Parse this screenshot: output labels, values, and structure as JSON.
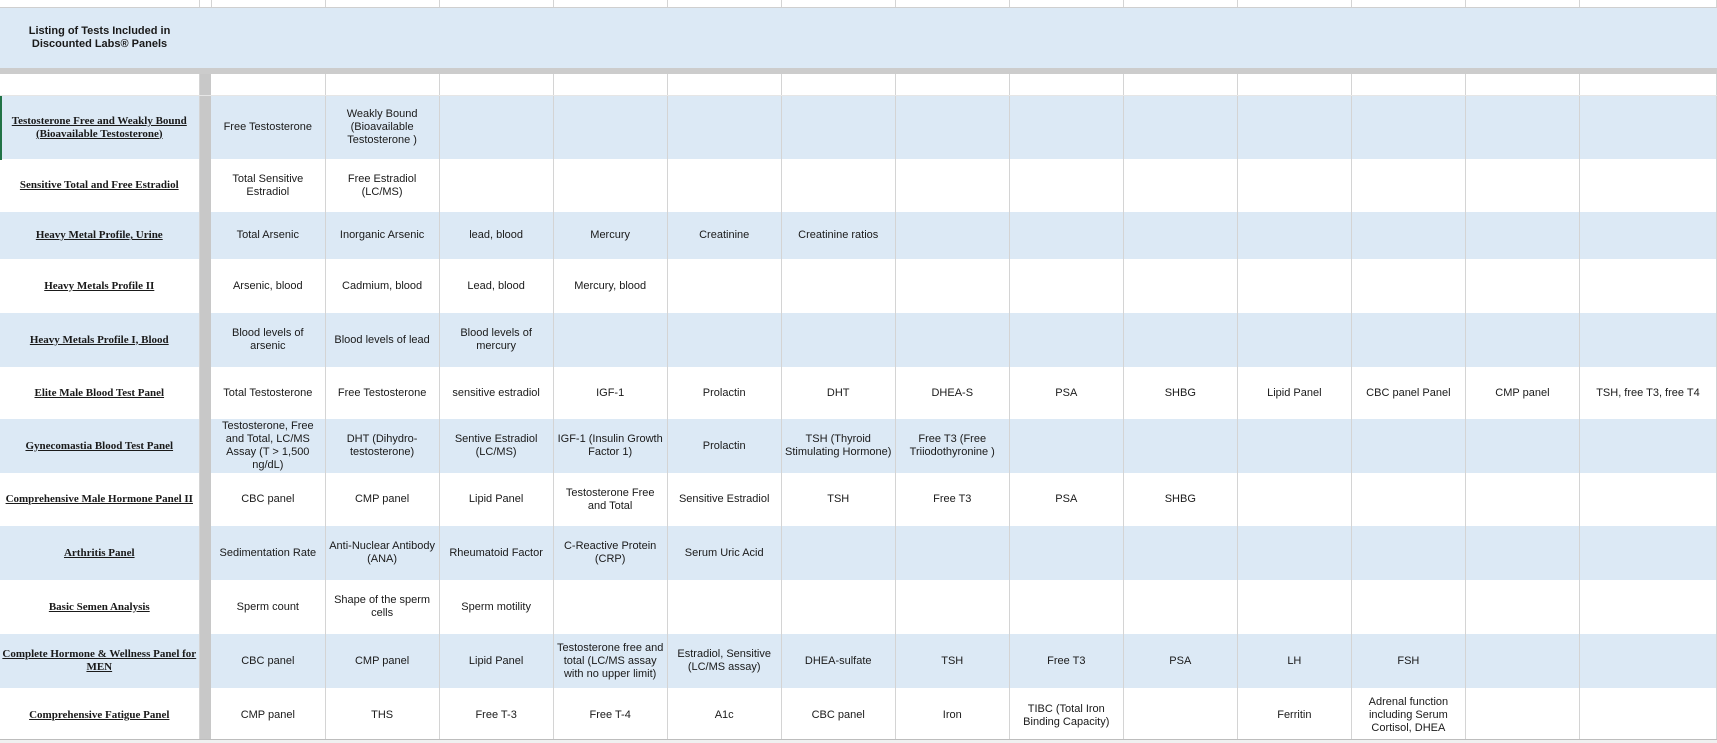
{
  "title_line1": "Listing of Tests Included in",
  "title_line2": "Discounted Labs® Panels",
  "rows": [
    {
      "panel": "Testosterone Free and Weakly Bound (Bioavailable Testosterone)",
      "tests": [
        "Free Testosterone",
        "Weakly  Bound (Bioavailable Testosterone )",
        "",
        "",
        "",
        "",
        "",
        "",
        "",
        "",
        "",
        "",
        ""
      ]
    },
    {
      "panel": "Sensitive Total and Free Estradiol",
      "tests": [
        "Total  Sensitive Estradiol",
        "Free  Estradiol (LC/MS)",
        "",
        "",
        "",
        "",
        "",
        "",
        "",
        "",
        "",
        "",
        ""
      ]
    },
    {
      "panel": "Heavy Metal Profile, Urine",
      "tests": [
        "Total Arsenic",
        "Inorganic Arsenic",
        "lead, blood",
        "Mercury",
        "Creatinine",
        "Creatinine  ratios",
        "",
        "",
        "",
        "",
        "",
        "",
        ""
      ]
    },
    {
      "panel": "Heavy Metals Profile II",
      "tests": [
        "Arsenic, blood",
        "Cadmium, blood",
        "Lead, blood",
        "Mercury, blood",
        "",
        "",
        "",
        "",
        "",
        "",
        "",
        "",
        ""
      ]
    },
    {
      "panel": "Heavy Metals Profile I, Blood",
      "tests": [
        "Blood levels of arsenic",
        "Blood levels of lead",
        "Blood levels of mercury",
        "",
        "",
        "",
        "",
        "",
        "",
        "",
        "",
        "",
        ""
      ]
    },
    {
      "panel": "Elite Male Blood Test Panel",
      "tests": [
        "Total Testosterone",
        "Free Testosterone",
        "sensitive estradiol",
        "IGF-1",
        "Prolactin",
        "DHT",
        "DHEA-S",
        "PSA",
        "SHBG",
        "Lipid Panel",
        "CBC panel Panel",
        "CMP panel",
        "TSH, free T3, free T4"
      ]
    },
    {
      "panel": "Gynecomastia Blood Test Panel",
      "tests": [
        "Testosterone, Free and Total, LC/MS Assay (T > 1,500 ng/dL)",
        "DHT (Dihydro-testosterone)",
        "Sentive Estradiol (LC/MS)",
        "IGF-1 (Insulin Growth Factor 1)",
        "Prolactin",
        "TSH (Thyroid Stimulating Hormone)",
        "Free T3 (Free Triiodothyronine )",
        "",
        "",
        "",
        "",
        "",
        ""
      ]
    },
    {
      "panel": "Comprehensive Male Hormone Panel II",
      "tests": [
        "CBC panel",
        "CMP panel",
        "Lipid Panel",
        "Testosterone Free and Total",
        "Sensitive Estradiol",
        "TSH",
        "Free T3",
        "PSA",
        "SHBG",
        "",
        "",
        "",
        ""
      ]
    },
    {
      "panel": "Arthritis Panel",
      "tests": [
        "Sedimentation Rate",
        "Anti-Nuclear Antibody (ANA)",
        "Rheumatoid Factor",
        "C-Reactive Protein (CRP)",
        "Serum Uric Acid",
        "",
        "",
        "",
        "",
        "",
        "",
        "",
        ""
      ]
    },
    {
      "panel": "Basic Semen Analysis",
      "tests": [
        "Sperm count",
        "Shape of the sperm cells",
        "Sperm motility",
        "",
        "",
        "",
        "",
        "",
        "",
        "",
        "",
        "",
        ""
      ]
    },
    {
      "panel": "Complete Hormone & Wellness Panel for MEN",
      "tests": [
        "CBC panel",
        "CMP panel",
        "Lipid Panel",
        "Testosterone free and total (LC/MS assay with no upper limit)",
        "Estradiol, Sensitive (LC/MS assay)",
        "DHEA-sulfate",
        "TSH",
        "Free T3",
        "PSA",
        "LH",
        "FSH",
        "",
        ""
      ]
    },
    {
      "panel": "Comprehensive Fatigue Panel",
      "tests": [
        "CMP panel",
        "THS",
        "Free T-3",
        "Free T-4",
        "A1c",
        "CBC panel",
        "Iron",
        "TIBC (Total Iron Binding Capacity)",
        "",
        "Ferritin",
        "Adrenal function including Serum Cortisol, DHEA",
        "",
        ""
      ]
    }
  ]
}
